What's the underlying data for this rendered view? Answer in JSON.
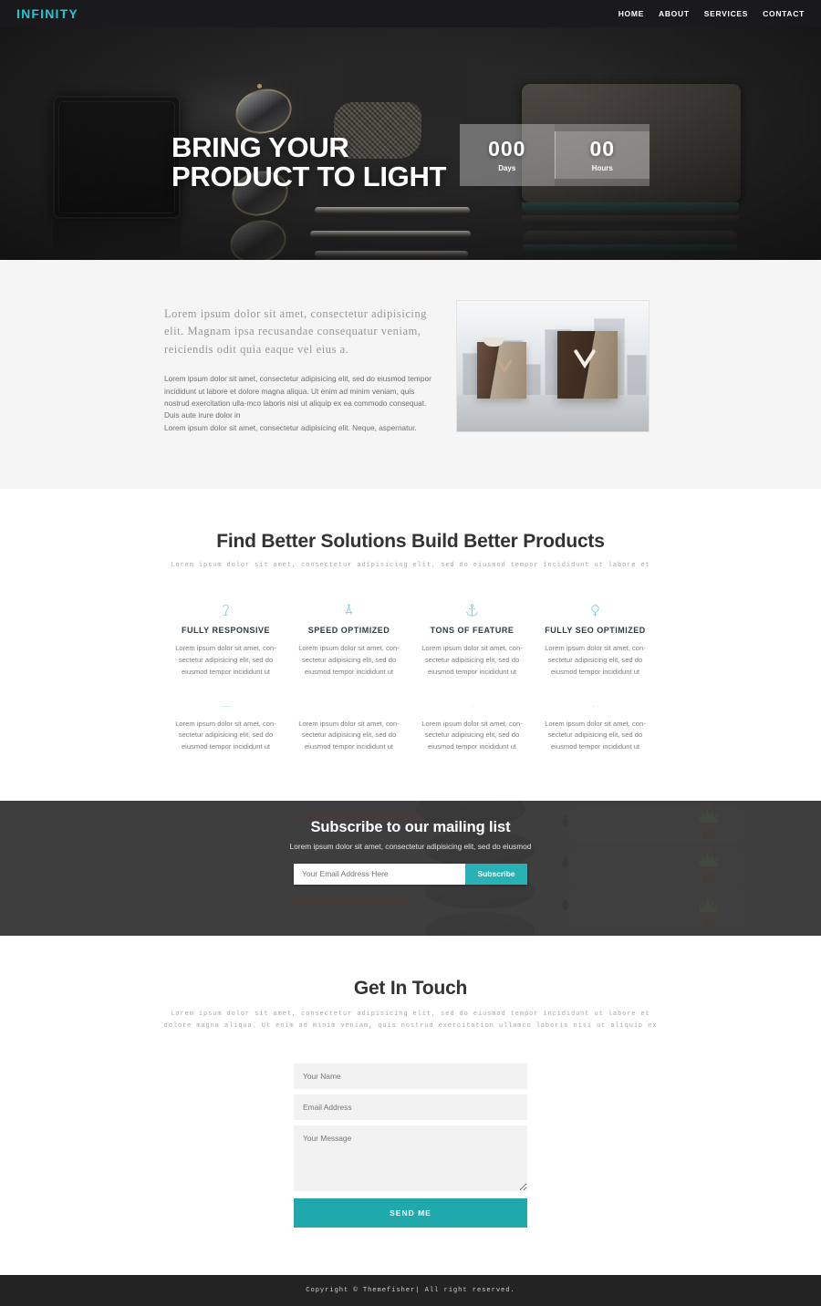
{
  "header": {
    "logo": "INFINITY",
    "nav": [
      {
        "label": "HOME"
      },
      {
        "label": "ABOUT"
      },
      {
        "label": "SERVICES"
      },
      {
        "label": "CONTACT"
      }
    ]
  },
  "hero": {
    "title_line1": "BRING YOUR",
    "title_line2": "PRODUCT TO LIGHT",
    "countdown": [
      {
        "value": "000",
        "label": "Days"
      },
      {
        "value": "00",
        "label": "Hours"
      }
    ]
  },
  "about": {
    "lead": "Lorem ipsum dolor sit amet, consectetur adipisicing elit. Magnam ipsa recusandae consequatur veniam, reiciendis odit quia eaque vel eius a.",
    "paragraph1": "Lorem ipsum dolor sit amet, consectetur adipisicing elit, sed do eiusmod tempor incididunt ut labore et dolore magna aliqua. Ut enim ad minim veniam, quis nostrud exercitation ulla-mco laboris nisi ut aliquip ex ea commodo consequat. Duis aute irure dolor in",
    "paragraph2": "Lorem ipsum dolor sit amet, consectetur adipisicing elit. Neque, aspernatur."
  },
  "features": {
    "title": "Find Better Solutions Build Better Products",
    "subtitle": "Lorem ipsum dolor sit amet, consectetur adipisicing elit, sed do eiusmod tempor incididunt ut labore et",
    "body_text": "Lorem ipsum dolor sit amet, con-sectetur adipisicing elit, sed do eiusmod tempor incididunt ut",
    "row1": [
      {
        "icon": "pen-nib-icon",
        "title": "FULLY RESPONSIVE"
      },
      {
        "icon": "compass-tool-icon",
        "title": "SPEED OPTIMIZED"
      },
      {
        "icon": "anchor-icon",
        "title": "TONS OF FEATURE"
      },
      {
        "icon": "magnifier-icon",
        "title": "FULLY SEO OPTIMIZED"
      }
    ],
    "row2": [
      {
        "icon": "partial-icon-1"
      },
      {
        "icon": "partial-icon-2"
      },
      {
        "icon": "partial-icon-3"
      },
      {
        "icon": "partial-icon-4"
      }
    ]
  },
  "subscribe": {
    "title": "Subscribe to our mailing list",
    "subtitle": "Lorem ipsum dolor sit amet, consectetur adipisicing elit, sed do eiusmod",
    "email_placeholder": "Your Email Address Here",
    "email_value": "",
    "button": "Subscribe"
  },
  "contact": {
    "title": "Get In Touch",
    "subtitle": "Lorem ipsum dolor sit amet, consectetur adipisicing elit, sed do eiusmod tempor incididunt ut labore et dolore magna aliqua. Ut enim ad minim veniam, quis nostrud exercitation ullamco laboris nisi ut aliquip ex",
    "name_placeholder": "Your Name",
    "name_value": "",
    "email_placeholder": "Email Address",
    "email_value": "",
    "message_placeholder": "Your Message",
    "message_value": "",
    "submit": "SEND ME"
  },
  "footer": {
    "copyright": "Copyright © Themefisher| All right reserved."
  },
  "colors": {
    "accent_teal": "#29b2b5",
    "accent_button": "#1fa9ad",
    "logo_cyan": "#1fc9d4",
    "icon_blue": "#6ec9d8",
    "dark_bar": "#1a1a1c",
    "footer_bg": "#232323",
    "about_bg": "#f5f5f5",
    "subscribe_bg": "#3f3f3f"
  }
}
